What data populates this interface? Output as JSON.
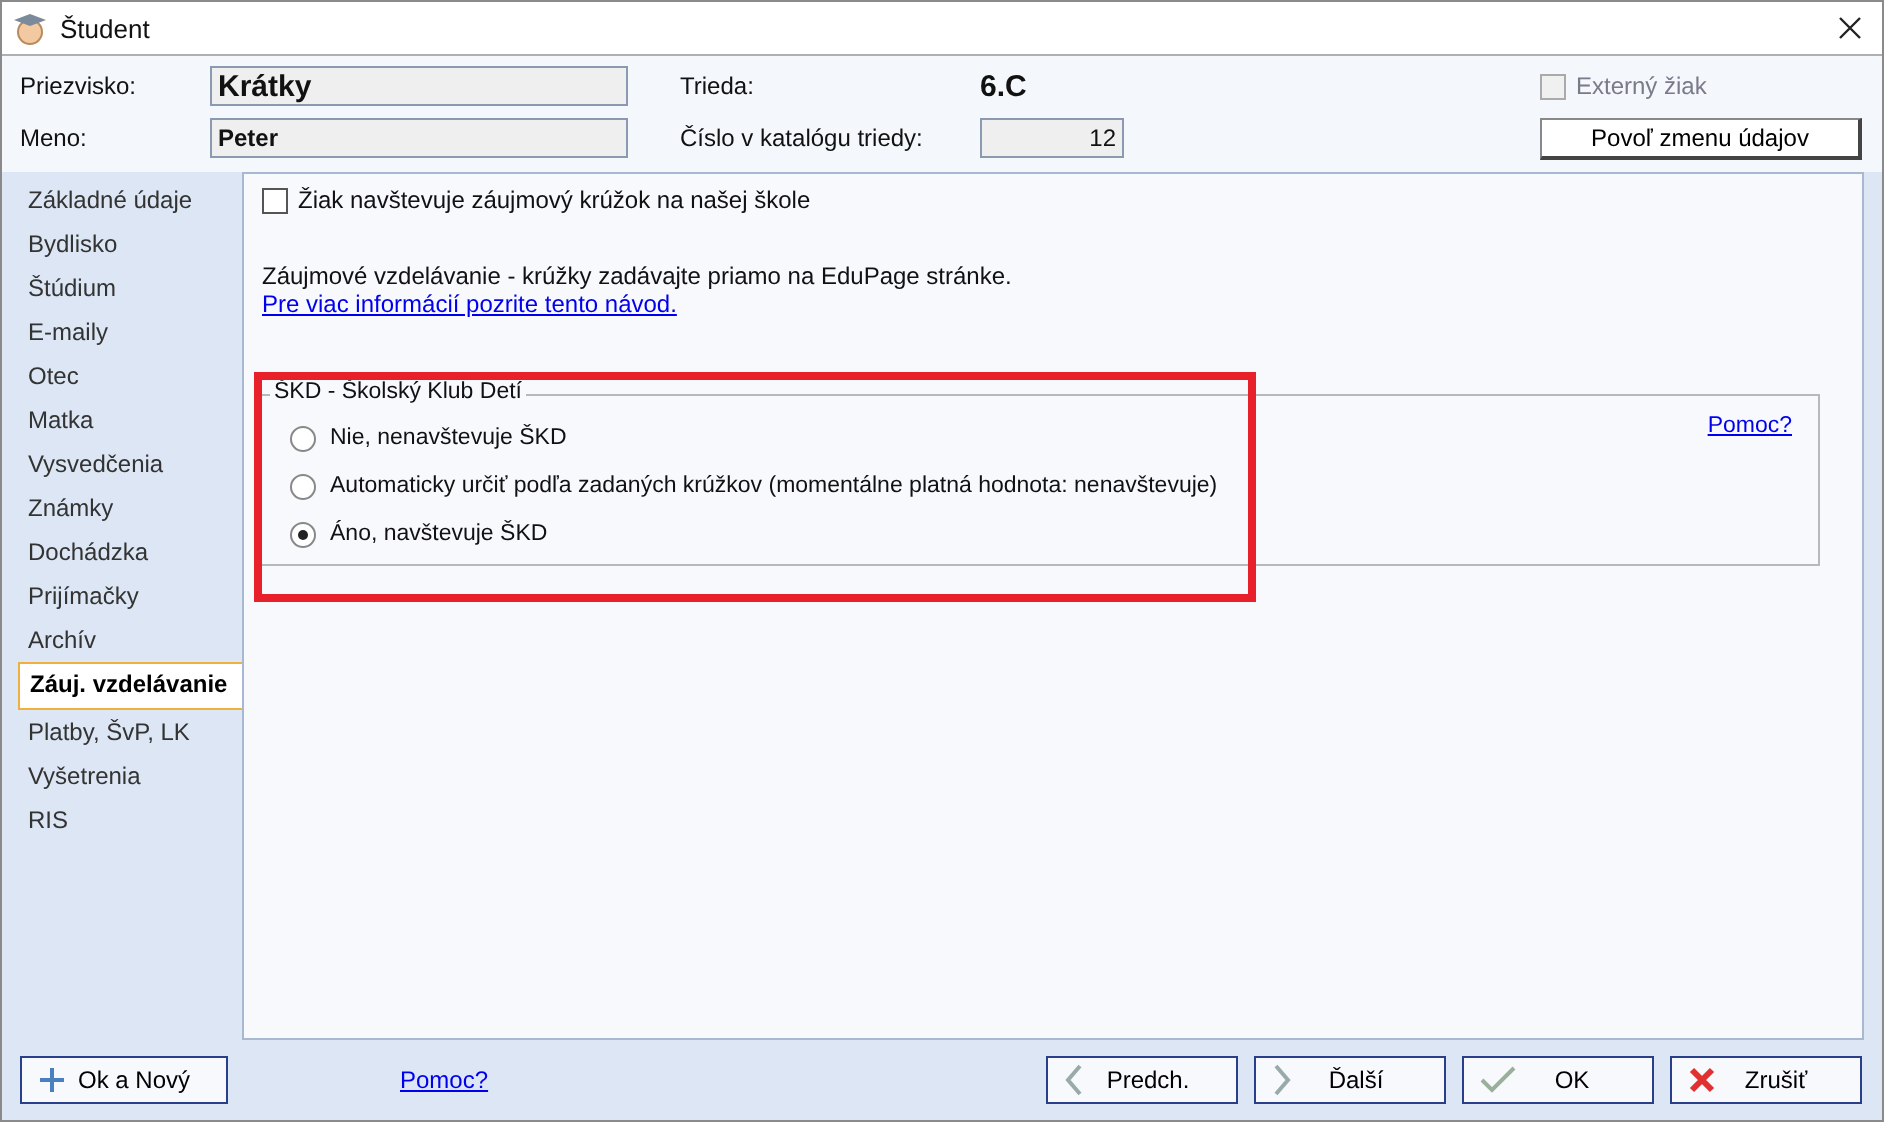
{
  "window": {
    "title": "Študent"
  },
  "student": {
    "surname_label": "Priezvisko:",
    "surname": "Krátky",
    "name_label": "Meno:",
    "name": "Peter",
    "class_label": "Trieda:",
    "class": "6.C",
    "catalog_label": "Číslo v katalógu triedy:",
    "catalog_number": "12",
    "external": {
      "label": "Externý žiak",
      "checked": false,
      "disabled": true
    },
    "unlock_button": "Povoľ zmenu údajov"
  },
  "sidebar": {
    "items": [
      {
        "label": "Základné údaje",
        "selected": false
      },
      {
        "label": "Bydlisko",
        "selected": false
      },
      {
        "label": "Štúdium",
        "selected": false
      },
      {
        "label": "E-maily",
        "selected": false
      },
      {
        "label": "Otec",
        "selected": false
      },
      {
        "label": "Matka",
        "selected": false
      },
      {
        "label": "Vysvedčenia",
        "selected": false
      },
      {
        "label": "Známky",
        "selected": false
      },
      {
        "label": "Dochádzka",
        "selected": false
      },
      {
        "label": "Prijímačky",
        "selected": false
      },
      {
        "label": "Archív",
        "selected": false
      },
      {
        "label": "Záuj. vzdelávanie",
        "selected": true
      },
      {
        "label": "Platby, ŠvP, LK",
        "selected": false
      },
      {
        "label": "Vyšetrenia",
        "selected": false
      },
      {
        "label": "RIS",
        "selected": false
      }
    ]
  },
  "content": {
    "club_checkbox": {
      "label": "Žiak navštevuje záujmový krúžok na našej škole",
      "checked": false
    },
    "info_text": "Záujmové vzdelávanie - krúžky zadávajte priamo na EduPage stránke.",
    "info_link": "Pre viac informácií pozrite tento návod.",
    "skd_group": {
      "title": "ŠKD - Školský Klub Detí",
      "help_link": "Pomoc?",
      "options": [
        {
          "label": "Nie, nenavštevuje ŠKD",
          "selected": false
        },
        {
          "label": "Automaticky určiť podľa zadaných krúžkov (momentálne platná hodnota: nenavštevuje)",
          "selected": false
        },
        {
          "label": "Áno, navštevuje ŠKD",
          "selected": true
        }
      ]
    }
  },
  "footer": {
    "ok_new_button": "Ok a Nový",
    "help_link": "Pomoc?",
    "buttons": [
      {
        "kind": "prev",
        "label": "Predch."
      },
      {
        "kind": "next",
        "label": "Ďalší"
      },
      {
        "kind": "ok",
        "label": "OK"
      },
      {
        "kind": "cancel",
        "label": "Zrušiť"
      }
    ]
  }
}
